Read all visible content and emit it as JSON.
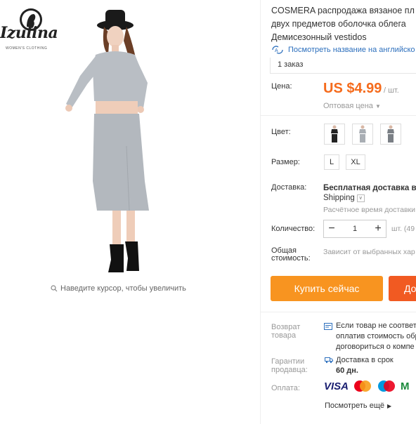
{
  "store": {
    "logo_main": "Izulina",
    "logo_sub": "WOMEN'S CLOTHING"
  },
  "gallery": {
    "zoom_hint": "Наведите курсор, чтобы увеличить"
  },
  "product": {
    "title_lines": [
      "COSMERA распродажа вязаное пл",
      "двух предметов оболочка облега",
      "Демисезонный vestidos"
    ],
    "translate_link": "Посмотреть название на английско",
    "orders": "1 заказ"
  },
  "price": {
    "label": "Цена:",
    "value": "US $4.99",
    "unit": "/ шт.",
    "wholesale": "Оптовая цена"
  },
  "color": {
    "label": "Цвет:",
    "options": [
      "black-set",
      "grey-set",
      "dark-grey-set"
    ]
  },
  "size": {
    "label": "Размер:",
    "options": [
      "L",
      "XL"
    ]
  },
  "shipping": {
    "label": "Доставка:",
    "main": "Бесплатная доставка в R",
    "method": "Shipping",
    "estimate": "Расчётное время доставки"
  },
  "quantity": {
    "label": "Количество:",
    "value": "1",
    "minus": "−",
    "plus": "+",
    "stock": "шт. (49"
  },
  "total": {
    "label_lines": [
      "Общая",
      "стоимость:"
    ],
    "value": "Зависит от выбранных хар"
  },
  "actions": {
    "buy_now": "Купить сейчас",
    "add_to_cart": "До"
  },
  "returns": {
    "label_lines": [
      "Возврат",
      "товара"
    ],
    "text_lines": [
      "Если товар не соответс",
      "оплатив стоимость обр",
      "договориться о компе"
    ]
  },
  "guarantee": {
    "label_lines": [
      "Гарантии",
      "продавца:"
    ],
    "text_lines": [
      "Доставка в срок",
      "60 дн."
    ]
  },
  "payment": {
    "label": "Оплата:",
    "visa": "VISA",
    "more": "Посмотреть ещё"
  },
  "colors": {
    "accent": "#f56b1c",
    "buy_button": "#f89420",
    "cart_button": "#f15a22",
    "link": "#2c6fbd"
  }
}
